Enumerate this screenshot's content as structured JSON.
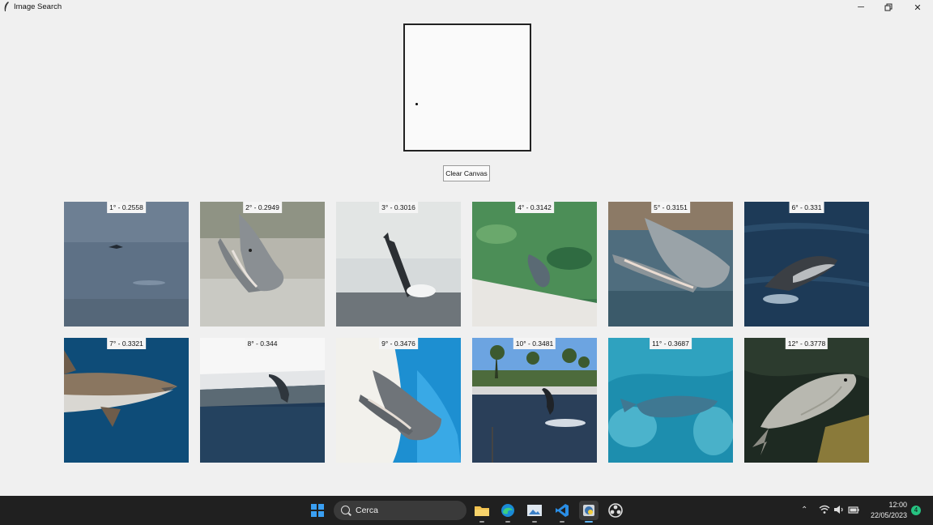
{
  "window": {
    "title": "Image Search",
    "minimize_icon": "minimize-icon",
    "maximize_icon": "restore-icon",
    "close_icon": "close-icon"
  },
  "canvas": {
    "clear_button_label": "Clear Canvas"
  },
  "results": [
    {
      "label": "1° - 0.2558",
      "subject": "dolphin distant at sea"
    },
    {
      "label": "2° - 0.2949",
      "subject": "dolphin head out of water"
    },
    {
      "label": "3° - 0.3016",
      "subject": "dolphin jumping vertically"
    },
    {
      "label": "4° - 0.3142",
      "subject": "dolphin in green pool"
    },
    {
      "label": "5° - 0.3151",
      "subject": "dolphin head with open mouth"
    },
    {
      "label": "6° - 0.331",
      "subject": "dolphin leaping from dark sea"
    },
    {
      "label": "7° - 0.3321",
      "subject": "shark underwater"
    },
    {
      "label": "8° - 0.344",
      "subject": "dolphin jumping in pool"
    },
    {
      "label": "9° - 0.3476",
      "subject": "dolphin head open mouth blue pool"
    },
    {
      "label": "10° - 0.3481",
      "subject": "dolphin show with palm trees"
    },
    {
      "label": "11° - 0.3687",
      "subject": "manatee underwater"
    },
    {
      "label": "12° - 0.3778",
      "subject": "carp fish"
    }
  ],
  "taskbar": {
    "search_placeholder": "Cerca",
    "time": "12:00",
    "date": "22/05/2023",
    "notification_count": "4",
    "apps": [
      "file-explorer-icon",
      "edge-icon",
      "photos-icon",
      "vscode-icon",
      "python-icon",
      "obs-icon"
    ]
  }
}
